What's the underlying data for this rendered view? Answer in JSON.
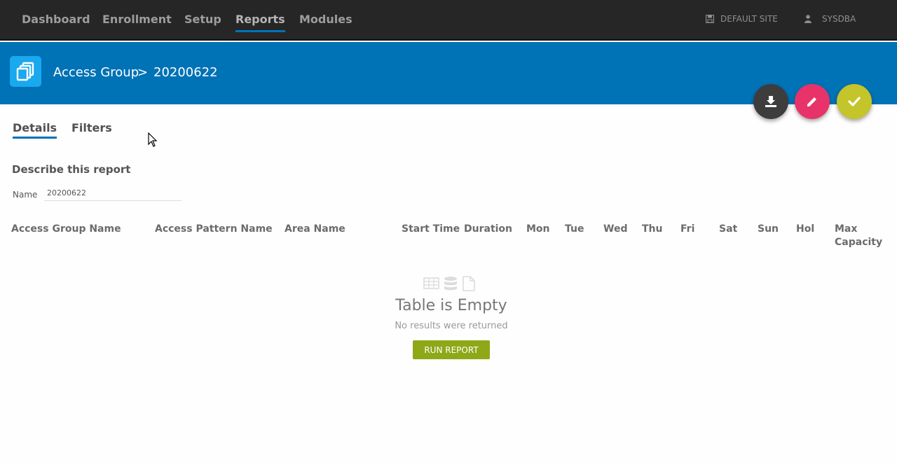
{
  "nav": {
    "items": [
      {
        "label": "Dashboard"
      },
      {
        "label": "Enrollment"
      },
      {
        "label": "Setup"
      },
      {
        "label": "Reports"
      },
      {
        "label": "Modules"
      }
    ],
    "active": "Reports",
    "site": "DEFAULT SITE",
    "user": "SYSDBA"
  },
  "header": {
    "crumb_parent": "Access Group",
    "separator": ">",
    "crumb_current": "20200622"
  },
  "actions": {
    "download_color": "#3d3d3d",
    "edit_color": "#e8336a",
    "confirm_color": "#c4c42b"
  },
  "tabs": [
    {
      "label": "Details"
    },
    {
      "label": "Filters"
    }
  ],
  "form": {
    "section_title": "Describe this report",
    "name_label": "Name",
    "name_value": "20200622"
  },
  "table": {
    "columns": [
      {
        "label": "Access Group Name"
      },
      {
        "label": "Access Pattern Name"
      },
      {
        "label": "Area Name"
      },
      {
        "label": "Start Time"
      },
      {
        "label": "Duration"
      },
      {
        "label": "Mon"
      },
      {
        "label": "Tue"
      },
      {
        "label": "Wed"
      },
      {
        "label": "Thu"
      },
      {
        "label": "Fri"
      },
      {
        "label": "Sat"
      },
      {
        "label": "Sun"
      },
      {
        "label": "Hol"
      },
      {
        "label": "Max"
      },
      {
        "label": "Capacity"
      }
    ],
    "empty_title": "Table is Empty",
    "empty_subtitle": "No results were returned",
    "run_button": "RUN REPORT"
  }
}
